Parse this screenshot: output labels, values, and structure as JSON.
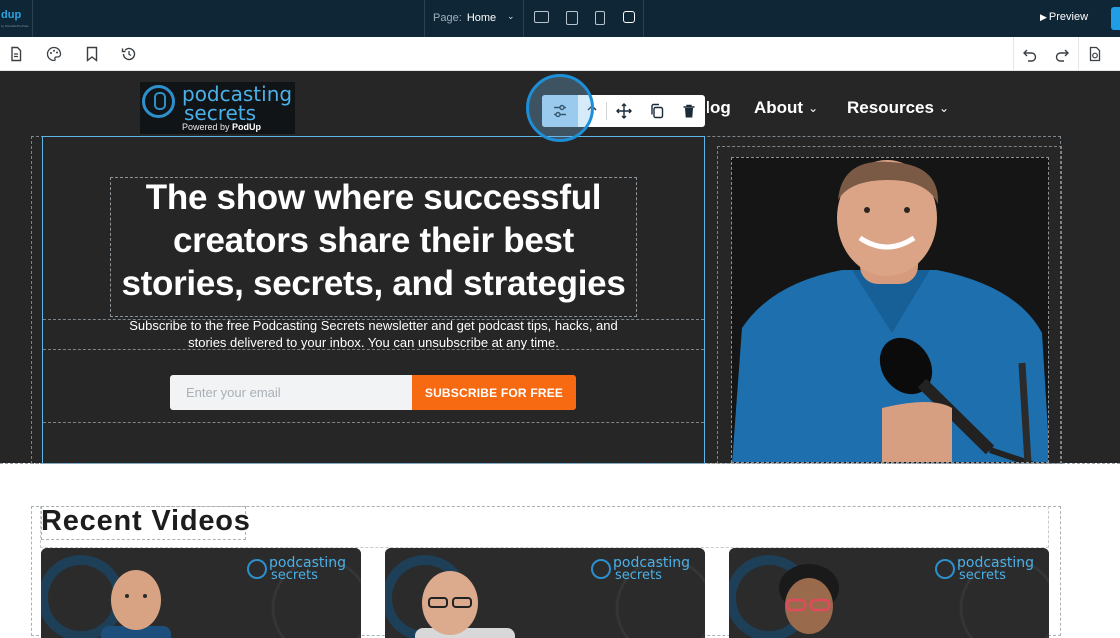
{
  "topbar": {
    "logo_text": "dup",
    "logo_sub": "by ShowMeThePods",
    "page_label": "Page:",
    "page_value": "Home",
    "devices": [
      "desktop-icon",
      "tablet-landscape-icon",
      "tablet-portrait-icon",
      "mobile-icon"
    ],
    "preview_label": "Preview"
  },
  "subbar": {
    "left_icons": [
      "page-icon",
      "palette-icon",
      "bookmark-icon",
      "history-icon"
    ],
    "right_icons": [
      "undo-icon",
      "redo-icon",
      "export-icon"
    ]
  },
  "site": {
    "logo": {
      "line1": "podcasting",
      "line2": "secrets",
      "powered_prefix": "Powered by",
      "powered_brand": "PodUp"
    },
    "nav": [
      {
        "label": "Blog",
        "has_menu": false
      },
      {
        "label": "About",
        "has_menu": true
      },
      {
        "label": "Resources",
        "has_menu": true
      }
    ],
    "element_toolbar": [
      "settings-sliders-icon",
      "arrow-up-icon",
      "move-icon",
      "duplicate-icon",
      "trash-icon"
    ],
    "hero": {
      "heading": "The show where successful creators share their best stories, secrets, and strategies",
      "subtext": "Subscribe to the free Podcasting Secrets newsletter and get podcast tips, hacks, and stories delivered to your inbox. You can unsubscribe at any time.",
      "email_placeholder": "Enter your email",
      "cta": "SUBSCRIBE FOR FREE"
    },
    "recent": {
      "title": "Recent Videos",
      "cards": [
        {
          "logo_line1": "podcasting",
          "logo_line2": "secrets"
        },
        {
          "logo_line1": "podcasting",
          "logo_line2": "secrets"
        },
        {
          "logo_line1": "podcasting",
          "logo_line2": "secrets"
        }
      ]
    }
  },
  "colors": {
    "toolbar_bg": "#0f2636",
    "brand_blue": "#2d8fcc",
    "cta_orange": "#f76a12",
    "selection_blue": "#5fb5e8"
  }
}
